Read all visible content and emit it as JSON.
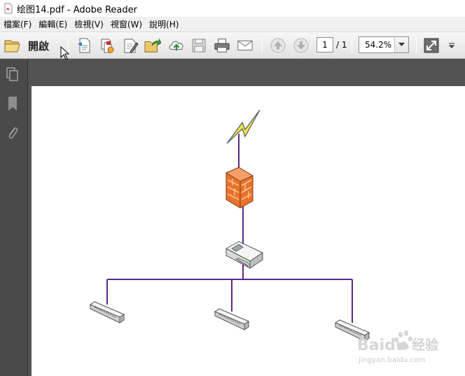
{
  "window": {
    "title": "绘图14.pdf - Adobe Reader"
  },
  "menu": {
    "items": [
      {
        "label": "檔案(F)"
      },
      {
        "label": "編輯(E)"
      },
      {
        "label": "檢視(V)"
      },
      {
        "label": "視窗(W)"
      },
      {
        "label": "說明(H)"
      }
    ]
  },
  "toolbar": {
    "open_label": "開啟",
    "page_current": "1",
    "page_total": "/ 1",
    "zoom": "54.2%"
  },
  "icons": {
    "app": "pdf-file-icon",
    "open": "folder-open-icon",
    "create": "create-pdf-icon",
    "combine": "combine-files-icon",
    "edit": "edit-pdf-icon",
    "export": "export-pdf-icon",
    "upload": "upload-cloud-icon",
    "save": "save-icon",
    "print": "printer-icon",
    "email": "email-icon",
    "prev": "arrow-up-icon",
    "next": "arrow-down-icon",
    "fullscreen": "fullscreen-icon",
    "overflow": "overflow-icon",
    "pages": "pages-panel-icon",
    "bookmarks": "bookmark-icon",
    "attachments": "paperclip-icon"
  },
  "watermark": {
    "brand": "Baidu",
    "brand_cn": "经验",
    "url": "jingyan.baidu.com"
  },
  "colors": {
    "link_line": "#5b2a86",
    "firewall": "#e8732a",
    "lightning": "#f2e83a"
  }
}
